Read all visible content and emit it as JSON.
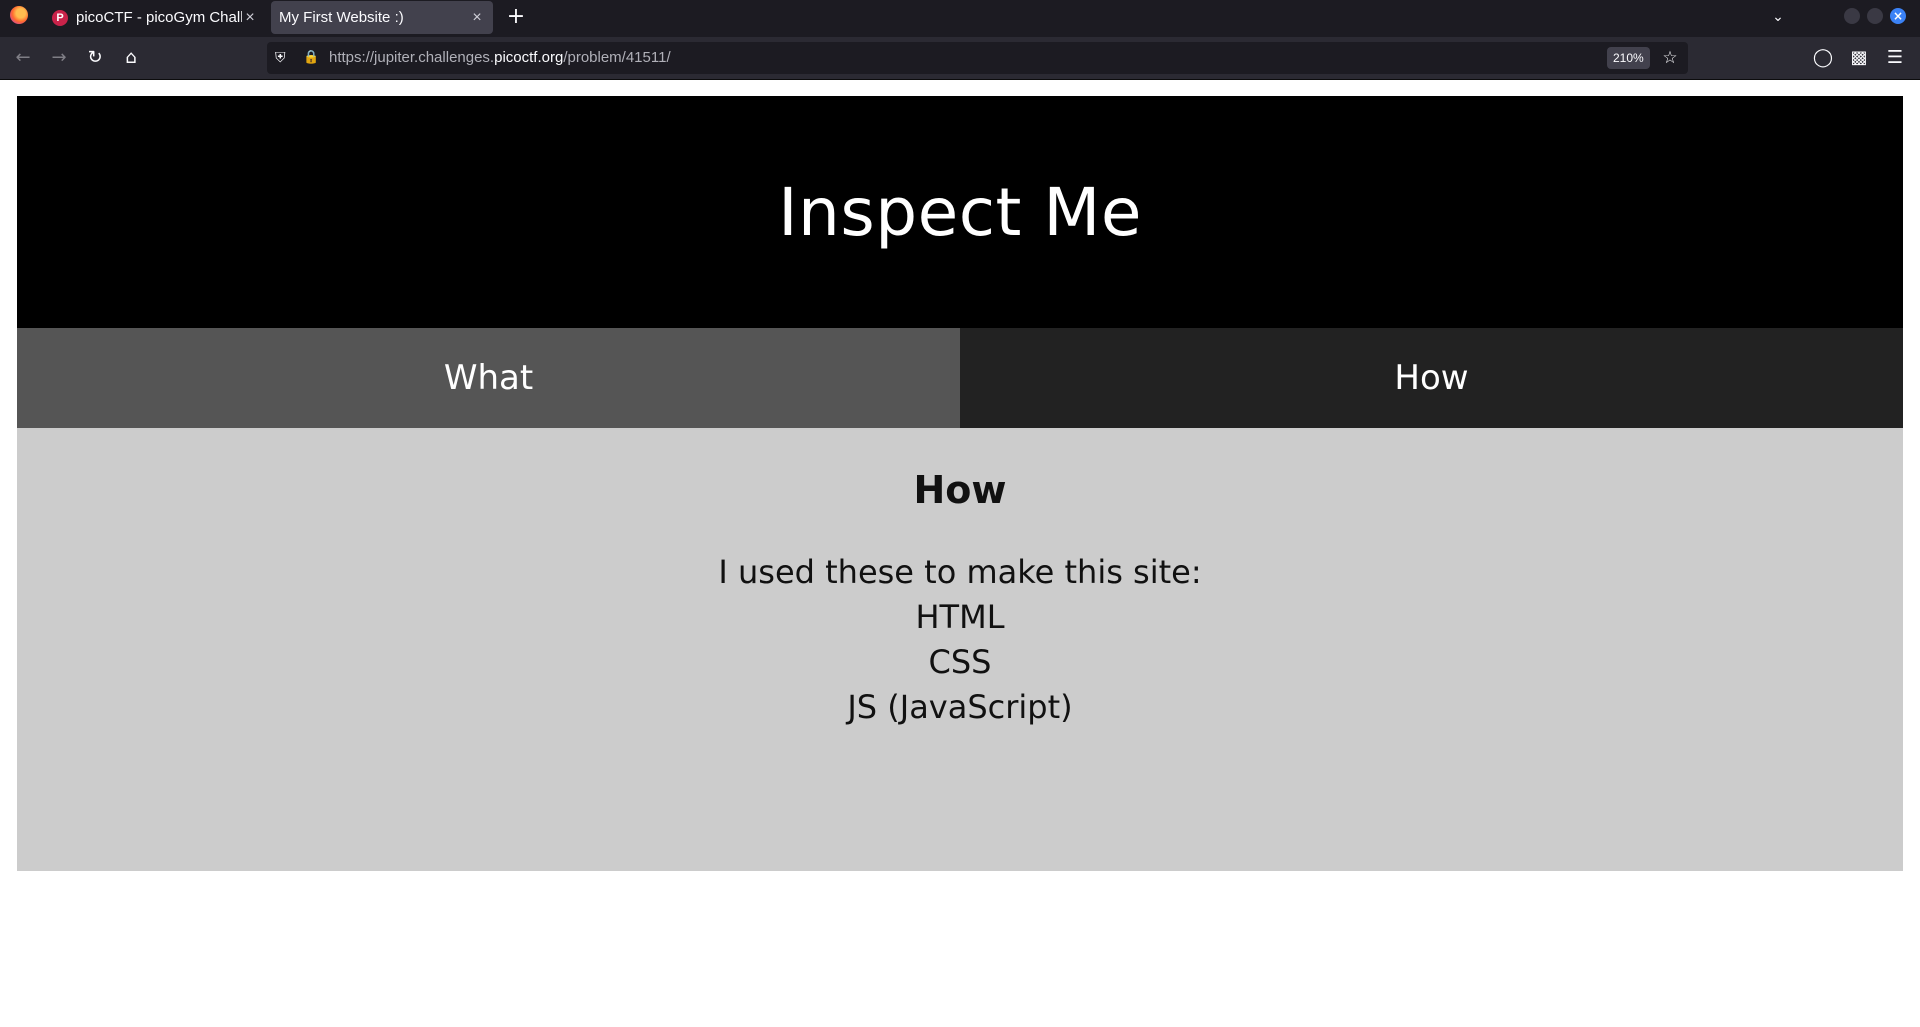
{
  "browser": {
    "tabs": [
      {
        "title": "picoCTF - picoGym Challenges",
        "favicon": "picoctf-icon",
        "active": false
      },
      {
        "title": "My First Website :)",
        "active": true
      }
    ],
    "url": {
      "prefix": "https://jupiter.challenges.",
      "host": "picoctf.org",
      "path": "/problem/41511/"
    },
    "zoom": "210%"
  },
  "site": {
    "title": "Inspect Me",
    "tabs": [
      {
        "label": "What"
      },
      {
        "label": "How"
      }
    ],
    "panel": {
      "heading": "How",
      "lines": [
        "I used these to make this site:",
        "HTML",
        "CSS",
        "JS (JavaScript)"
      ]
    }
  },
  "colors": {
    "header_bg": "#000000",
    "tab_what_bg": "#555555",
    "tab_how_bg": "#222222",
    "panel_bg": "#cccccc"
  }
}
